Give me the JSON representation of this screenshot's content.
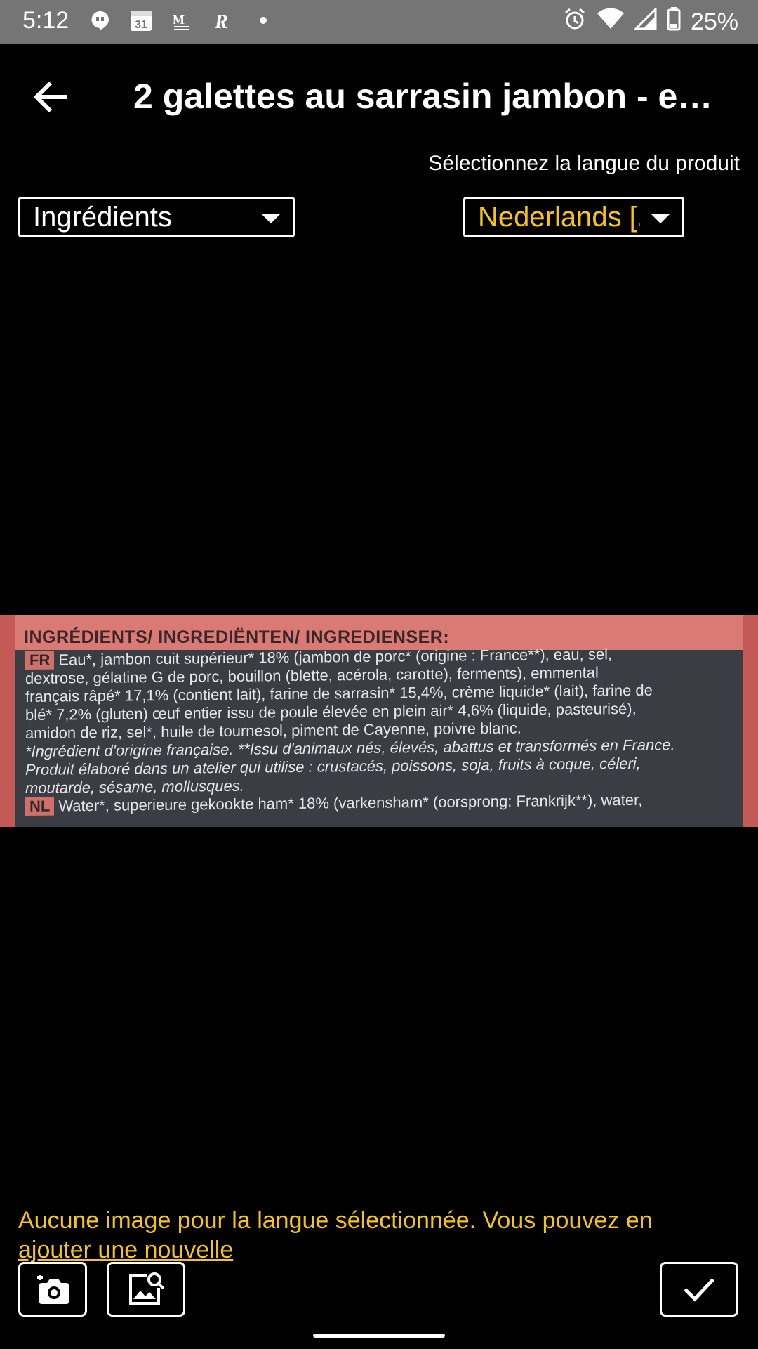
{
  "status_bar": {
    "time": "5:12",
    "icons_left": [
      "hangouts-icon",
      "calendar-icon",
      "gmail-icon",
      "app-r-icon",
      "dot-icon"
    ],
    "calendar_day": "31",
    "battery": "25%"
  },
  "app_bar": {
    "title": "2 galettes au sarrasin jambon - em…"
  },
  "language_hint": "Sélectionnez la langue du produit",
  "image_type_dropdown": {
    "selected": "Ingrédients"
  },
  "language_dropdown": {
    "selected": "Nederlands [.."
  },
  "photo": {
    "header": "INGRÉDIENTS/ INGREDIËNTEN/ INGREDIENSER:",
    "fr_tag": "FR",
    "fr_lines": [
      "Eau*, jambon cuit supérieur* 18% (jambon de porc* (origine : France**), eau, sel,",
      "dextrose, gélatine G de porc, bouillon (blette, acérola, carotte), ferments), emmental",
      "français râpé* 17,1% (contient lait), farine de sarrasin* 15,4%, crème liquide* (lait), farine de",
      "blé* 7,2% (gluten) œuf entier issu de poule élevée en plein air* 4,6% (liquide, pasteurisé),",
      "amidon de riz, sel*, huile de tournesol, piment de Cayenne, poivre blanc.",
      "*Ingrédient d'origine française. **Issu d'animaux nés, élevés, abattus et transformés en France.",
      "Produit élaboré dans un atelier qui utilise : crustacés, poissons, soja, fruits à coque, céleri,",
      "moutarde, sésame, mollusques."
    ],
    "nl_tag": "NL",
    "nl_line": "Water*, superieure gekookte ham* 18% (varkensham* (oorsprong: Frankrijk**), water,"
  },
  "no_image_message": {
    "text": "Aucune image pour la langue sélectionnée. Vous pouvez en",
    "link": "ajouter une nouvelle"
  },
  "colors": {
    "accent": "#f5c518",
    "status_bar": "#757575",
    "background": "#000000"
  }
}
